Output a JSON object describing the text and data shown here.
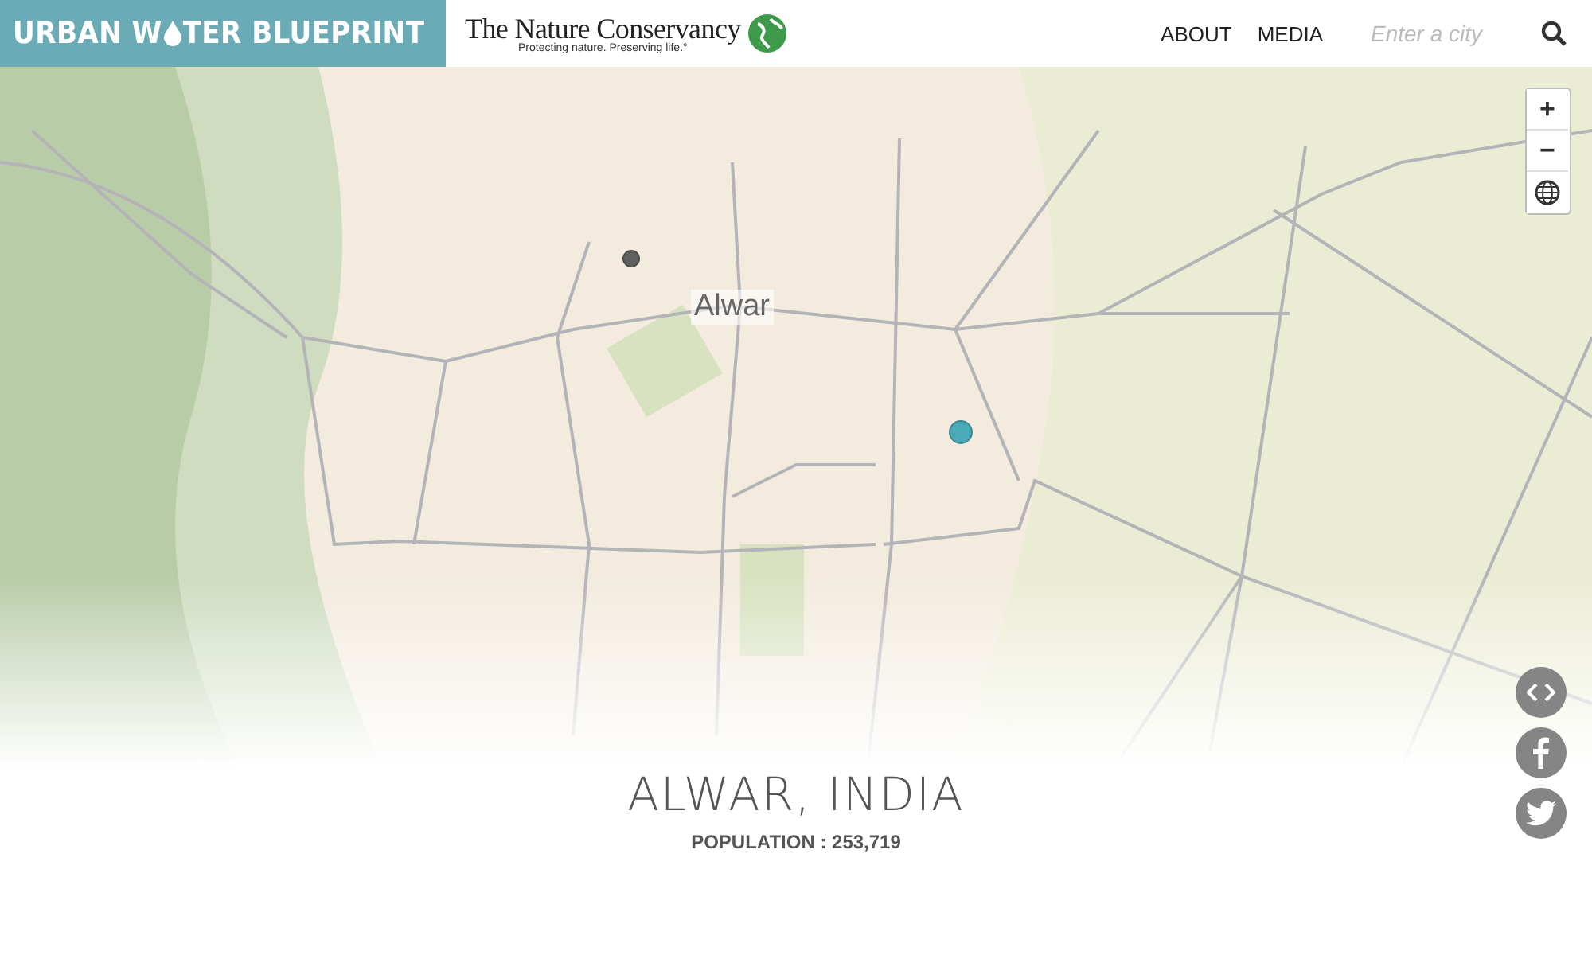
{
  "header": {
    "brand": {
      "before": "URBAN W",
      "after": "TER BLUEPRINT"
    },
    "partner": {
      "name": "The Nature Conservancy",
      "tagline": "Protecting nature. Preserving life.°"
    },
    "nav": [
      {
        "label": "ABOUT"
      },
      {
        "label": "MEDIA"
      }
    ],
    "search": {
      "placeholder": "Enter a city"
    }
  },
  "map": {
    "city_label": "Alwar",
    "markers": [
      {
        "color": "#606060"
      },
      {
        "color": "#4aaab8"
      }
    ],
    "zoom_controls": [
      {
        "kind": "zoom-in",
        "label": "+"
      },
      {
        "kind": "zoom-out",
        "label": "−"
      },
      {
        "kind": "globe"
      }
    ]
  },
  "city": {
    "title": "ALWAR, INDIA",
    "population": "POPULATION : 253,719"
  },
  "share": [
    {
      "kind": "embed"
    },
    {
      "kind": "facebook"
    },
    {
      "kind": "twitter"
    }
  ]
}
